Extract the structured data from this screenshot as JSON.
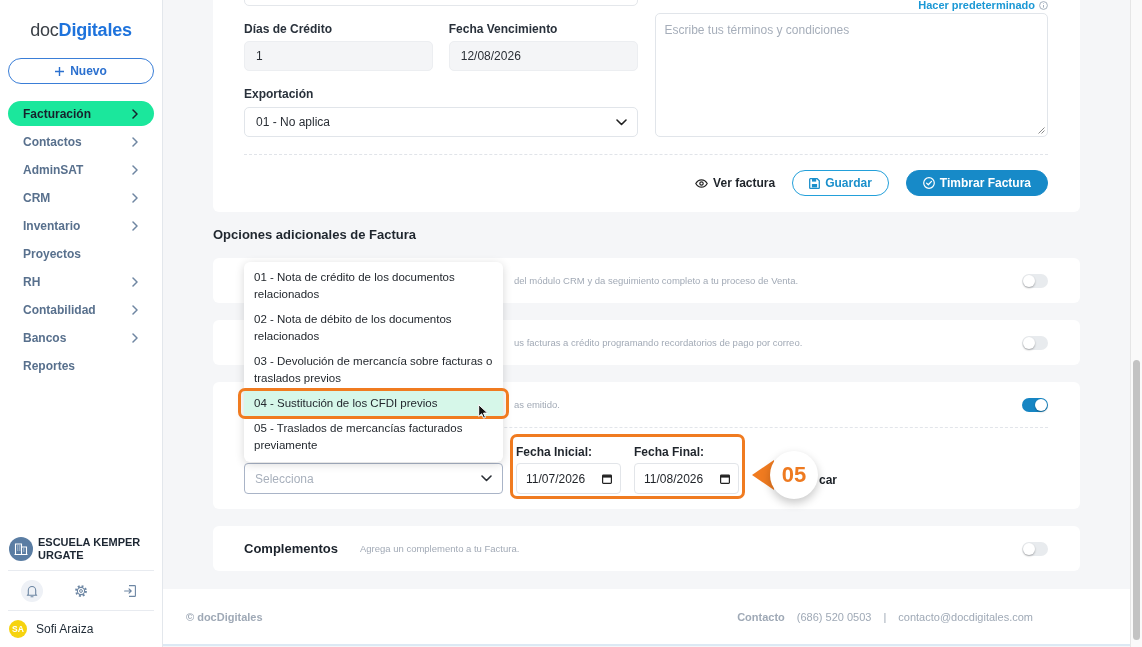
{
  "sidebar": {
    "logo": "doc**Digitales**",
    "new_button": "Nuevo",
    "nav": [
      {
        "label": "Facturación",
        "selected": true,
        "submenu": true
      },
      {
        "label": "Contactos",
        "selected": false,
        "submenu": true
      },
      {
        "label": "AdminSAT",
        "selected": false,
        "submenu": true
      },
      {
        "label": "CRM",
        "selected": false,
        "submenu": true
      },
      {
        "label": "Inventario",
        "selected": false,
        "submenu": true
      },
      {
        "label": "Proyectos",
        "selected": false,
        "submenu": false
      },
      {
        "label": "RH",
        "selected": false,
        "submenu": true
      },
      {
        "label": "Contabilidad",
        "selected": false,
        "submenu": true
      },
      {
        "label": "Bancos",
        "selected": false,
        "submenu": true
      },
      {
        "label": "Reportes",
        "selected": false,
        "submenu": false
      }
    ],
    "company": "ESCUELA KEMPER URGATE",
    "user": {
      "initials": "SA",
      "name": "Sofi Araiza"
    }
  },
  "invoice": {
    "fields": [
      {
        "label": "Días de Crédito",
        "value": "1"
      },
      {
        "label": "Fecha Vencimiento",
        "value": "12/08/2026"
      }
    ],
    "export": {
      "label": "Exportación",
      "value": "01 - No aplica"
    },
    "terms": {
      "link": "Hacer predeterminado",
      "placeholder": "Escribe tus términos y condiciones"
    },
    "actions": [
      {
        "kind": "link",
        "label": "Ver factura"
      },
      {
        "kind": "outline",
        "label": "Guardar"
      },
      {
        "kind": "primary",
        "label": "Timbrar Factura"
      }
    ]
  },
  "options_heading": "Opciones adicionales de Factura",
  "option_cards": [
    {
      "kind": "plain",
      "description": "del módulo CRM y da seguimiento completo a tu proceso de Venta.",
      "on": false
    },
    {
      "kind": "plain",
      "description": "us facturas a crédito programando recordatorios de pago por correo.",
      "on": false
    },
    {
      "kind": "related",
      "description": "as emitido.",
      "on": true,
      "relation": {
        "select": {
          "placeholder": "Selecciona",
          "options": [
            {
              "label": "01 - Nota de crédito de los documentos relacionados",
              "selected": false,
              "framed": false
            },
            {
              "label": "02 - Nota de débito de los documentos relacionados",
              "selected": false,
              "framed": false
            },
            {
              "label": "03 - Devolución de mercancía sobre facturas o traslados previos",
              "selected": false,
              "framed": false
            },
            {
              "label": "04 - Sustitución de los CFDI previos",
              "selected": true,
              "framed": true
            },
            {
              "label": "05 - Traslados de mercancías facturados previamente",
              "selected": false,
              "framed": false
            }
          ]
        },
        "date_range": {
          "framed": true,
          "step": "05",
          "fields": [
            {
              "label": "Fecha Inicial:",
              "value": "11/07/2026"
            },
            {
              "label": "Fecha Final:",
              "value": "11/08/2026"
            }
          ]
        },
        "trailing_text": "car"
      }
    },
    {
      "kind": "plain",
      "title": "Complementos",
      "description": "Agrega un complemento a tu Factura.",
      "on": false
    }
  ],
  "footer": {
    "copyright": "© docDigitales",
    "contact_label": "Contacto",
    "phone": "(686) 520 0503",
    "separator": "|",
    "email": "contacto@docdigitales.com"
  }
}
